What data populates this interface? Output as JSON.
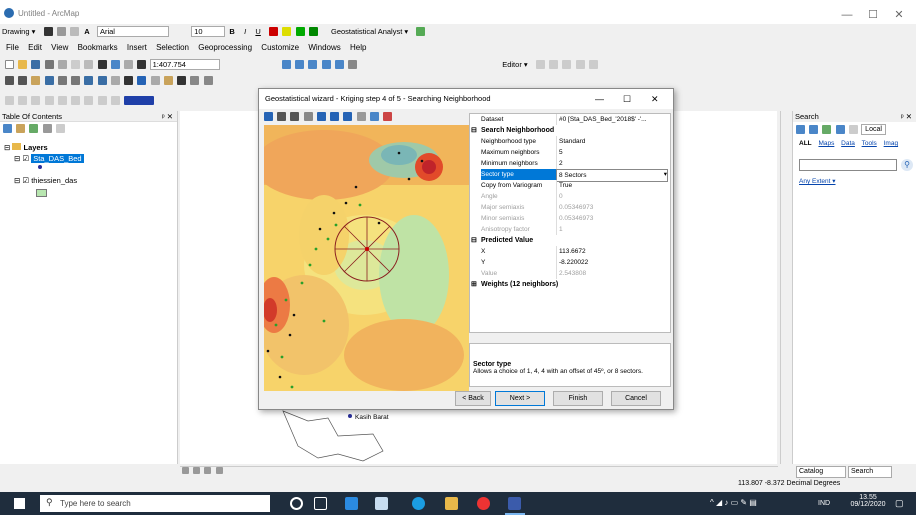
{
  "window": {
    "title": "Untitled - ArcMap",
    "min": "—",
    "max": "☐",
    "close": "✕"
  },
  "toolbars": {
    "drawing_label": "Drawing ▾",
    "font_name": "Arial",
    "font_size": "10",
    "bold": "B",
    "italic": "I",
    "underline": "U",
    "font_color": "A",
    "geostat_label": "Geostatistical Analyst ▾",
    "scale": "1:407.754",
    "editor_label": "Editor ▾"
  },
  "menu": [
    "File",
    "Edit",
    "View",
    "Bookmarks",
    "Insert",
    "Selection",
    "Geoprocessing",
    "Customize",
    "Windows",
    "Help"
  ],
  "toc": {
    "title": "Table Of Contents",
    "pin": "ᵖ ✕",
    "layers_label": "Layers",
    "layer1": "Sta_DAS_Bed",
    "layer2": "thiessien_das"
  },
  "map": {
    "place_label": "Kasih Barat"
  },
  "dialog": {
    "title": "Geostatistical wizard - Kriging step 4 of 5 - Searching Neighborhood",
    "min": "—",
    "max": "☐",
    "close": "✕",
    "properties": [
      {
        "key": "Dataset",
        "value": "#0 [Sta_DAS_Bed_'2018$' -'...",
        "kind": "normal"
      },
      {
        "key": "Search Neighborhood",
        "value": "",
        "kind": "section"
      },
      {
        "key": "Neighborhood type",
        "value": "Standard",
        "kind": "normal"
      },
      {
        "key": "Maximum neighbors",
        "value": "5",
        "kind": "normal"
      },
      {
        "key": "Minimum neighbors",
        "value": "2",
        "kind": "normal"
      },
      {
        "key": "Sector type",
        "value": "8 Sectors",
        "kind": "selected"
      },
      {
        "key": "Copy from Variogram",
        "value": "True",
        "kind": "normal"
      },
      {
        "key": "Angle",
        "value": "0",
        "kind": "grey"
      },
      {
        "key": "Major semiaxis",
        "value": "0.05346973",
        "kind": "grey"
      },
      {
        "key": "Minor semiaxis",
        "value": "0.05346973",
        "kind": "grey"
      },
      {
        "key": "Anisotropy factor",
        "value": "1",
        "kind": "grey"
      },
      {
        "key": "Predicted Value",
        "value": "",
        "kind": "section"
      },
      {
        "key": "X",
        "value": "113.6672",
        "kind": "normal"
      },
      {
        "key": "Y",
        "value": "-8.220022",
        "kind": "normal"
      },
      {
        "key": "Value",
        "value": "2.543808",
        "kind": "grey"
      },
      {
        "key": "Weights (12 neighbors)",
        "value": "",
        "kind": "section-plus"
      }
    ],
    "desc_title": "Sector type",
    "desc_text": "Allows a choice of 1, 4, 4 with an offset of 45º, or 8 sectors.",
    "back": "< Back",
    "next": "Next >",
    "finish": "Finish",
    "cancel": "Cancel"
  },
  "search": {
    "title": "Search",
    "pin": "ᵖ ✕",
    "local": "Local",
    "filters": [
      "ALL",
      "Maps",
      "Data",
      "Tools",
      "Imag"
    ],
    "extent": "Any Extent ▾"
  },
  "bottom_tabs": {
    "catalog": "Catalog",
    "search": "Search"
  },
  "status": {
    "coords": "113.807  -8.372 Decimal Degrees"
  },
  "taskbar": {
    "search_placeholder": "Type here to search",
    "lang": "IND",
    "time": "13.55",
    "date": "09/12/2020"
  },
  "colors": {
    "accent": "#0078d7",
    "taskbar": "#1f2d3d",
    "selection": "#0078d7"
  }
}
